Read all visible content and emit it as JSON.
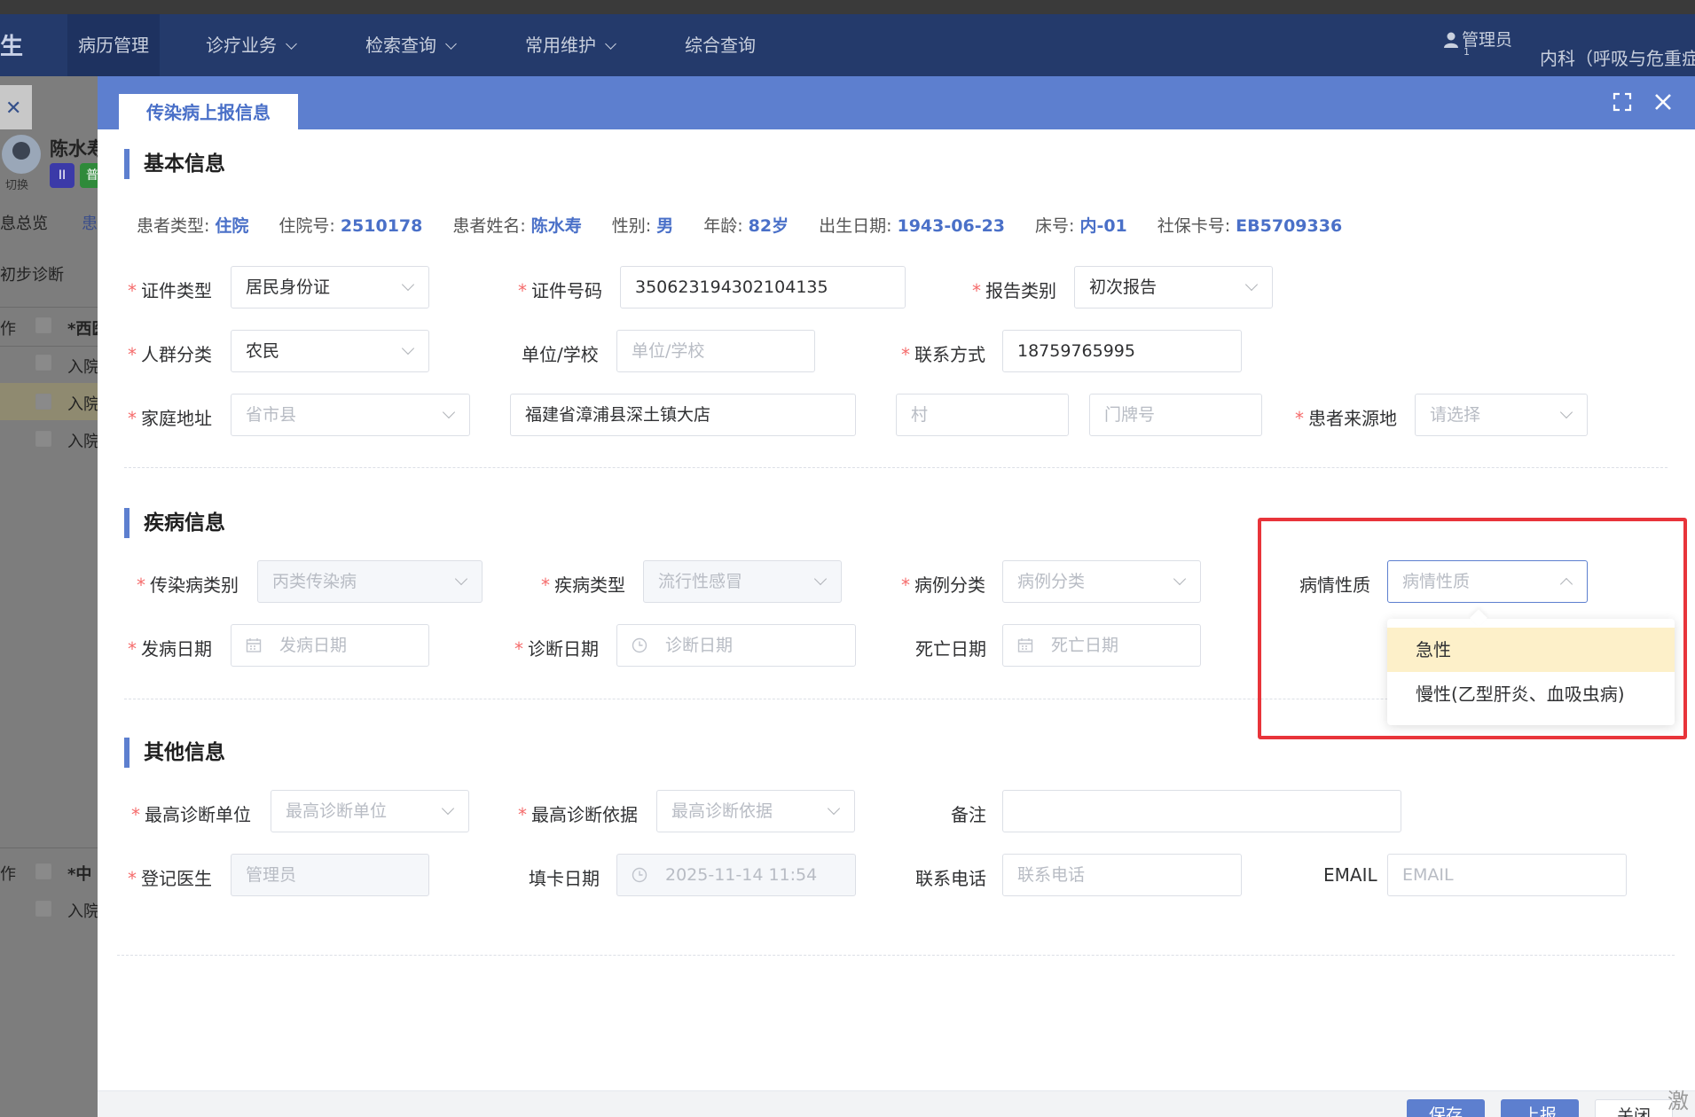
{
  "nav": {
    "brand": "生",
    "items": [
      {
        "label": "病历管理"
      },
      {
        "label": "诊疗业务"
      },
      {
        "label": "检索查询"
      },
      {
        "label": "常用维护"
      },
      {
        "label": "综合查询"
      }
    ],
    "user": "管理员",
    "user_sub": "1",
    "dept": "内科（呼吸与危重症"
  },
  "background": {
    "patient_name_fragment": "陈水寿",
    "switch_label": "切换",
    "chip1": "II",
    "chip2": "普",
    "tab1": "息总览",
    "tab2": "患",
    "diag_label": "初步诊断",
    "col_op": "作",
    "col_west": "*西医",
    "row_label": "入院",
    "col_op2": "作",
    "col_mid": "*中",
    "row_label2": "入院"
  },
  "modal": {
    "tab_title": "传染病上报信息"
  },
  "basic": {
    "title": "基本信息",
    "info": [
      {
        "k": "患者类型:",
        "v": "住院"
      },
      {
        "k": "住院号:",
        "v": "2510178"
      },
      {
        "k": "患者姓名:",
        "v": "陈水寿"
      },
      {
        "k": "性别:",
        "v": "男"
      },
      {
        "k": "年龄:",
        "v": "82岁"
      },
      {
        "k": "出生日期:",
        "v": "1943-06-23"
      },
      {
        "k": "床号:",
        "v": "内-01"
      },
      {
        "k": "社保卡号:",
        "v": "EB5709336"
      }
    ],
    "id_type_label": "证件类型",
    "id_type_value": "居民身份证",
    "id_no_label": "证件号码",
    "id_no_value": "350623194302104135",
    "report_type_label": "报告类别",
    "report_type_value": "初次报告",
    "crowd_label": "人群分类",
    "crowd_value": "农民",
    "unit_label": "单位/学校",
    "unit_placeholder": "单位/学校",
    "contact_label": "联系方式",
    "contact_value": "18759765995",
    "address_label": "家庭地址",
    "address_region_placeholder": "省市县",
    "address_detail_value": "福建省漳浦县深土镇大店",
    "village_placeholder": "村",
    "door_placeholder": "门牌号",
    "source_label": "患者来源地",
    "source_placeholder": "请选择"
  },
  "disease": {
    "title": "疾病信息",
    "category_label": "传染病类别",
    "category_value": "丙类传染病",
    "type_label": "疾病类型",
    "type_value": "流行性感冒",
    "case_label": "病例分类",
    "case_placeholder": "病例分类",
    "nature_label": "病情性质",
    "nature_placeholder": "病情性质",
    "onset_label": "发病日期",
    "onset_placeholder": "发病日期",
    "diag_label": "诊断日期",
    "diag_placeholder": "诊断日期",
    "death_label": "死亡日期",
    "death_placeholder": "死亡日期",
    "nature_options": [
      "急性",
      "慢性(乙型肝炎、血吸虫病)"
    ]
  },
  "other": {
    "title": "其他信息",
    "top_unit_label": "最高诊断单位",
    "top_unit_placeholder": "最高诊断单位",
    "top_basis_label": "最高诊断依据",
    "top_basis_placeholder": "最高诊断依据",
    "remark_label": "备注",
    "doctor_label": "登记医生",
    "doctor_value": "管理员",
    "fill_date_label": "填卡日期",
    "fill_date_value": "2025-11-14 11:54",
    "phone_label": "联系电话",
    "phone_placeholder": "联系电话",
    "email_label": "EMAIL",
    "email_placeholder": "EMAIL"
  },
  "footer": {
    "save": "保存",
    "report": "上报",
    "close": "关闭"
  },
  "corner_text": "激",
  "colors": {
    "accent": "#5d7fcf",
    "nav_bg": "#243a6b",
    "required": "#f56c6c",
    "highlight_border": "#e8343a",
    "option_hover": "#fdf0c9"
  }
}
